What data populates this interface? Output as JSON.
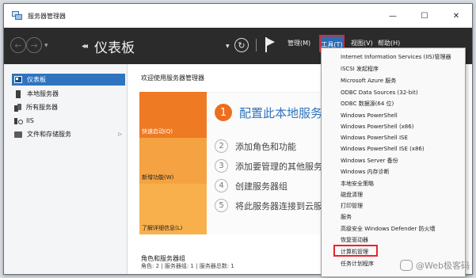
{
  "window": {
    "title": "服务器管理器",
    "controls": {
      "minimize": "—",
      "maximize": "☐",
      "close": "✕"
    }
  },
  "toolbar": {
    "back_glyph": "←",
    "forward_glyph": "→",
    "dropdown_glyph": "▼",
    "breadcrumb_arrows": "◂◂",
    "breadcrumb_title": "仪表板",
    "refresh_glyph": "↻",
    "menus": {
      "manage": "管理(M)",
      "tools": "工具(T)",
      "view": "视图(V)",
      "help": "帮助(H)"
    }
  },
  "sidebar": {
    "items": [
      {
        "label": "仪表板",
        "icon": "dashboard-icon",
        "active": true
      },
      {
        "label": "本地服务器",
        "icon": "server-icon"
      },
      {
        "label": "所有服务器",
        "icon": "servers-icon"
      },
      {
        "label": "IIS",
        "icon": "iis-icon"
      },
      {
        "label": "文件和存储服务",
        "icon": "folder-icon",
        "expander": "▷"
      }
    ]
  },
  "main": {
    "welcome": "欢迎使用服务器管理器",
    "tiles": {
      "quick_start": "快速启动(Q)",
      "new_features": "新增功能(W)",
      "learn_more": "了解详细信息(L)"
    },
    "steps": [
      {
        "num": "1",
        "text": "配置此本地服务器"
      },
      {
        "num": "2",
        "text": "添加角色和功能"
      },
      {
        "num": "3",
        "text": "添加要管理的其他服务器"
      },
      {
        "num": "4",
        "text": "创建服务器组"
      },
      {
        "num": "5",
        "text": "将此服务器连接到云服务"
      }
    ],
    "roles_title": "角色和服务器组",
    "roles_summary": "角色: 2 | 服务器组: 1 | 服务器总数: 1"
  },
  "tools_menu": {
    "items": [
      "Internet Information Services (IIS)管理器",
      "iSCSI 发起程序",
      "Microsoft Azure 服务",
      "ODBC Data Sources (32-bit)",
      "ODBC 数据源(64 位)",
      "Windows PowerShell",
      "Windows PowerShell (x86)",
      "Windows PowerShell ISE",
      "Windows PowerShell ISE (x86)",
      "Windows Server 备份",
      "Windows 内存诊断",
      "本地安全策略",
      "磁盘清理",
      "打印管理",
      "服务",
      "高级安全 Windows Defender 防火墙",
      "恢复驱动器",
      "计算机管理",
      "任务计划程序"
    ],
    "highlighted": "计算机管理"
  },
  "watermark": "@Web极客码",
  "colors": {
    "toolbar_bg": "#2b2b2b",
    "accent_blue": "#2e74c0",
    "highlight_red": "#e8242c",
    "quick_start_orange": "#ee7a23",
    "new_features_orange": "#f5a342",
    "learn_more_orange": "#f8b04c"
  }
}
